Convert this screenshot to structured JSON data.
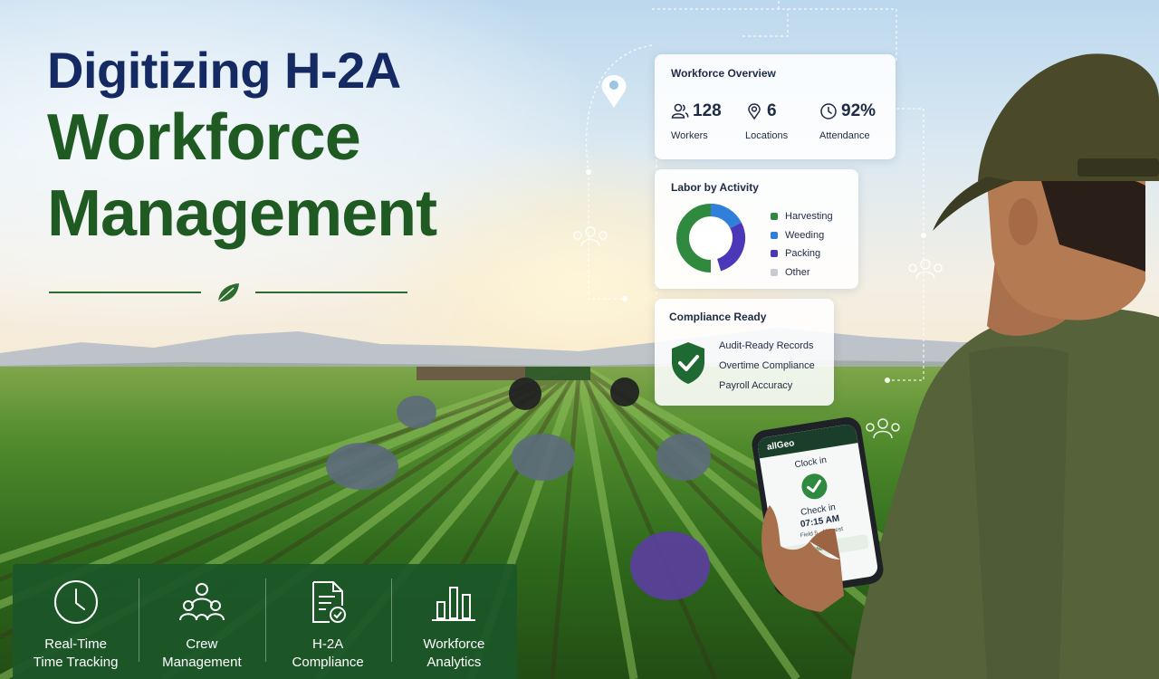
{
  "title": {
    "line1": "Digitizing H-2A",
    "line2": "Workforce",
    "line3": "Management"
  },
  "overview": {
    "title": "Workforce Overview",
    "stats": [
      {
        "icon": "users-icon",
        "value": "128",
        "label": "Workers"
      },
      {
        "icon": "location-pin-icon",
        "value": "6",
        "label": "Locations"
      },
      {
        "icon": "clock-icon",
        "value": "92%",
        "label": "Attendance"
      }
    ]
  },
  "labor": {
    "title": "Labor by Activity",
    "legend": [
      {
        "label": "Harvesting",
        "color": "#2f8a3f"
      },
      {
        "label": "Weeding",
        "color": "#2f7fdb"
      },
      {
        "label": "Packing",
        "color": "#4a38b8"
      },
      {
        "label": "Other",
        "color": "#c8ccd0"
      }
    ]
  },
  "compliance": {
    "title": "Compliance Ready",
    "items": [
      "Audit-Ready Records",
      "Overtime Compliance",
      "Payroll Accuracy"
    ]
  },
  "phone": {
    "brand": "allGeo",
    "clock_in": "Clock in",
    "check_in": "Check in",
    "time": "07:15 AM",
    "location": "Field 5 - Harvest",
    "gps": "GPS Verified"
  },
  "features": [
    {
      "icon": "clock-icon",
      "label": "Real-Time\nTime Tracking"
    },
    {
      "icon": "crew-icon",
      "label": "Crew\nManagement"
    },
    {
      "icon": "compliance-document-icon",
      "label": "H-2A\nCompliance"
    },
    {
      "icon": "bar-chart-icon",
      "label": "Workforce\nAnalytics"
    }
  ]
}
